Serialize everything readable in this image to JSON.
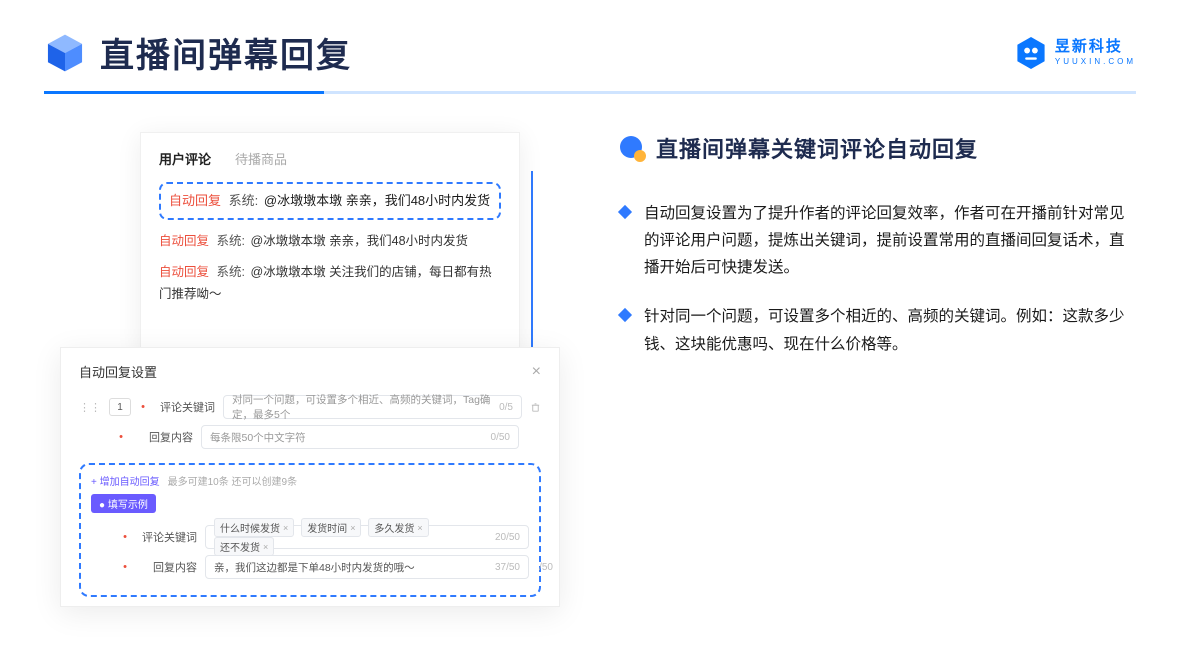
{
  "header": {
    "title": "直播间弹幕回复",
    "brand_cn": "昱新科技",
    "brand_en": "YUUXIN.COM"
  },
  "comments": {
    "tab_active": "用户评论",
    "tab_other": "待播商品",
    "hl_label": "自动回复",
    "hl_sys": "系统:",
    "hl_text": "@冰墩墩本墩 亲亲，我们48小时内发货",
    "rows": [
      {
        "label": "自动回复",
        "sys": "系统:",
        "text": "@冰墩墩本墩 亲亲，我们48小时内发货"
      },
      {
        "label": "自动回复",
        "sys": "系统:",
        "text": "@冰墩墩本墩 关注我们的店铺，每日都有热门推荐呦～"
      }
    ]
  },
  "settings": {
    "title": "自动回复设置",
    "close": "×",
    "idx": "1",
    "kw_label": "评论关键词",
    "kw_placeholder": "对同一个问题，可设置多个相近、高频的关键词，Tag确定，最多5个",
    "kw_count": "0/5",
    "content_label": "回复内容",
    "content_placeholder": "每条限50个中文字符",
    "content_count": "0/50",
    "example": {
      "add": "+ 增加自动回复",
      "limit": "最多可建10条 还可以创建9条",
      "badge": "● 填写示例",
      "kw_label": "评论关键词",
      "tags": [
        "什么时候发货",
        "发货时间",
        "多久发货",
        "还不发货"
      ],
      "kw_count": "20/50",
      "content_label": "回复内容",
      "content_value": "亲，我们这边都是下单48小时内发货的哦～",
      "content_count": "37/50",
      "outer_count": "/50"
    }
  },
  "right": {
    "title": "直播间弹幕关键词评论自动回复",
    "p1": "自动回复设置为了提升作者的评论回复效率，作者可在开播前针对常见的评论用户问题，提炼出关键词，提前设置常用的直播间回复话术，直播开始后可快捷发送。",
    "p2": "针对同一个问题，可设置多个相近的、高频的关键词。例如：这款多少钱、这块能优惠吗、现在什么价格等。"
  }
}
